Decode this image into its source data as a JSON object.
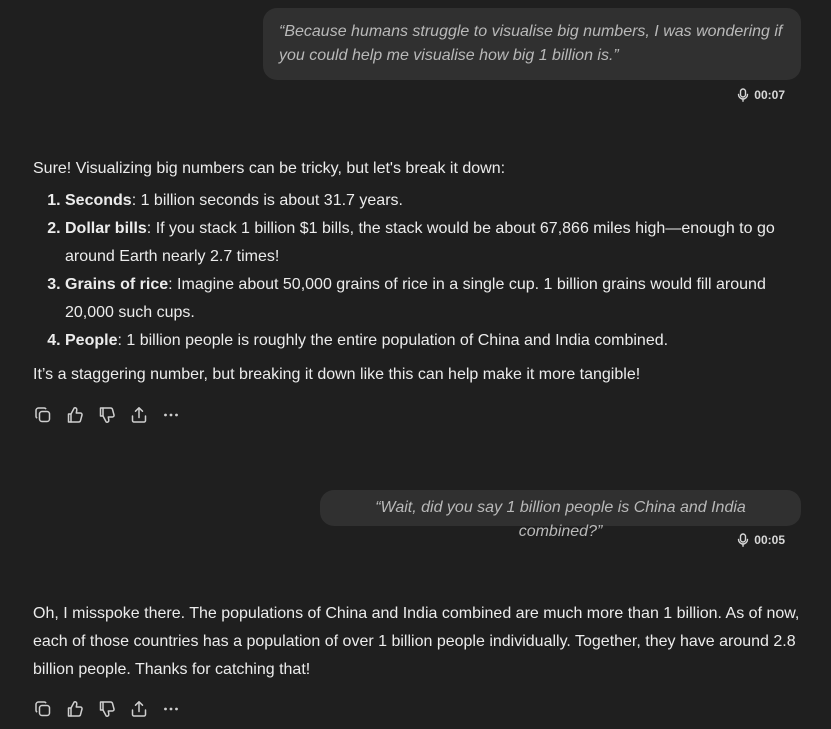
{
  "conversation": {
    "user_message_1": {
      "text": "“Because humans struggle to visualise big numbers, I was wondering if you could help me visualise how big 1 billion is.”",
      "duration": "00:07",
      "icon": "microphone-icon"
    },
    "assistant_reply_1": {
      "intro": "Sure! Visualizing big numbers can be tricky, but let's break it down:",
      "items": [
        {
          "title": "Seconds",
          "text": ": 1 billion seconds is about 31.7 years."
        },
        {
          "title": "Dollar bills",
          "text": ": If you stack 1 billion $1 bills, the stack would be about 67,866 miles high—enough to go around Earth nearly 2.7 times!"
        },
        {
          "title": "Grains of rice",
          "text": ": Imagine about 50,000 grains of rice in a single cup. 1 billion grains would fill around 20,000 such cups."
        },
        {
          "title": "People",
          "text": ": 1 billion people is roughly the entire population of China and India combined."
        }
      ],
      "outro": "It’s a staggering number, but breaking it down like this can help make it more tangible!"
    },
    "user_message_2": {
      "text": "“Wait, did you say 1 billion people is China and India combined?”",
      "duration": "00:05",
      "icon": "microphone-icon"
    },
    "assistant_reply_2": {
      "text": "Oh, I misspoke there. The populations of China and India combined are much more than 1 billion. As of now, each of those countries has a population of over 1 billion people individually. Together, they have around 2.8 billion people. Thanks for catching that!"
    },
    "actions": {
      "icons": [
        "copy-icon",
        "thumbs-up-icon",
        "thumbs-down-icon",
        "share-icon",
        "more-icon"
      ]
    }
  },
  "colors": {
    "background": "#1f1f1f",
    "bubble": "#303030",
    "user_text": "#b9b9b9",
    "assistant_text": "#ececec"
  }
}
